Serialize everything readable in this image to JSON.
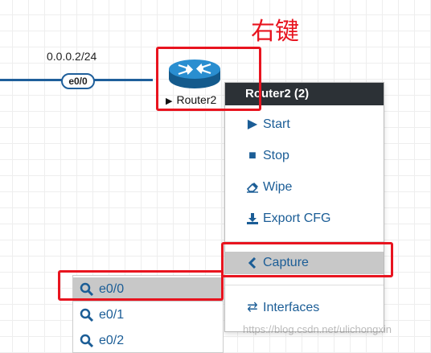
{
  "canvas": {
    "link_ip": "0.0.0.2/24",
    "link_port": "e0/0",
    "node_label": "Router2",
    "right_click_note": "右键"
  },
  "context_menu": {
    "header": "Router2 (2)",
    "items": [
      {
        "icon": "play-icon",
        "label": "Start"
      },
      {
        "icon": "stop-icon",
        "label": "Stop"
      },
      {
        "icon": "eraser-icon",
        "label": "Wipe"
      },
      {
        "icon": "download-icon",
        "label": "Export CFG"
      },
      {
        "icon": "chevron-left-icon",
        "label": "Capture"
      },
      {
        "icon": "swap-arrows-icon",
        "label": "Interfaces"
      }
    ]
  },
  "capture_submenu": {
    "items": [
      {
        "icon": "search-icon",
        "label": "e0/0"
      },
      {
        "icon": "search-icon",
        "label": "e0/1"
      },
      {
        "icon": "search-icon",
        "label": "e0/2"
      }
    ]
  },
  "watermark": "https://blog.csdn.net/ulichongxin",
  "colors": {
    "link": "#1f5f9b",
    "menu_text": "#1b5d96",
    "menu_header_bg": "#2c3136",
    "highlight": "#c8c8c8",
    "annotation": "#e8141f"
  }
}
